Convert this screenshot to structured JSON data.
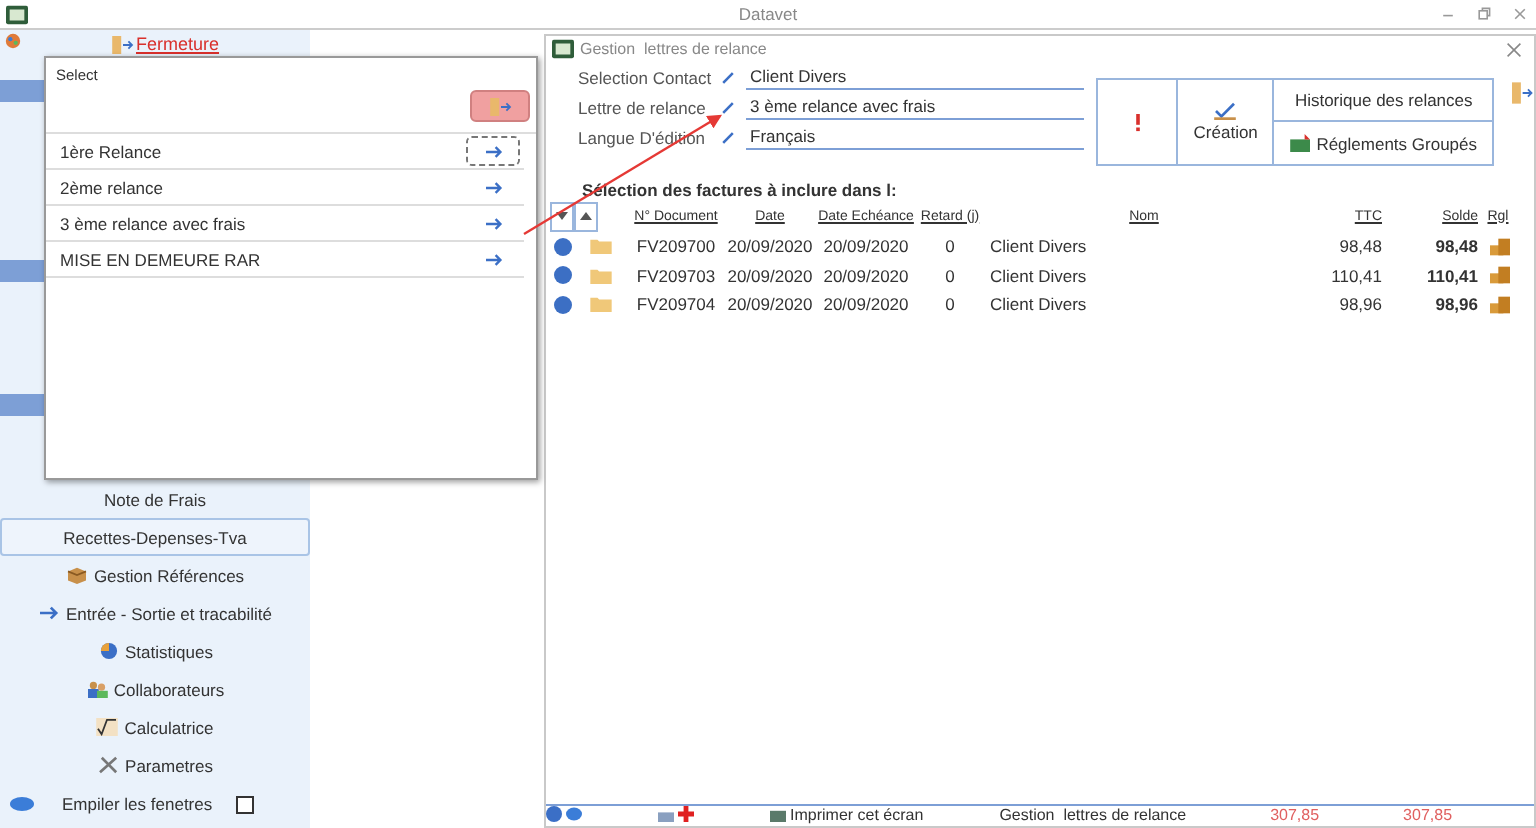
{
  "app": {
    "title": "Datavet"
  },
  "sidebar": {
    "close_link": "Fermeture",
    "items": [
      {
        "label": "Note de Frais",
        "selected": false
      },
      {
        "label": "Recettes-Depenses-Tva",
        "selected": true
      },
      {
        "label": "Gestion Références",
        "selected": false
      },
      {
        "label": "Entrée - Sortie et tracabilité",
        "selected": false
      },
      {
        "label": "Statistiques",
        "selected": false
      },
      {
        "label": "Collaborateurs",
        "selected": false
      },
      {
        "label": "Calculatrice",
        "selected": false
      },
      {
        "label": "Parametres",
        "selected": false
      }
    ],
    "stack_windows": {
      "label": "Empiler les fenetres",
      "checked": false
    }
  },
  "popup": {
    "title": "Select",
    "items": [
      {
        "label": "1ère Relance",
        "focused": true
      },
      {
        "label": "2ème relance",
        "focused": false
      },
      {
        "label": "3 ème relance avec frais",
        "focused": false
      },
      {
        "label": "MISE EN DEMEURE RAR",
        "focused": false
      }
    ]
  },
  "window": {
    "title": "Gestion  lettres de relance",
    "fields": [
      {
        "label": "Selection Contact",
        "value": "Client Divers"
      },
      {
        "label": "Lettre de relance",
        "value": "3 ème relance avec frais"
      },
      {
        "label": "Langue D'édition",
        "value": "Français"
      }
    ],
    "buttons": {
      "create": "Création",
      "history": "Historique des relances",
      "grouped": "Réglements Groupés"
    },
    "section_title": "Sélection des factures à inclure dans l:",
    "table": {
      "columns": [
        "N° Document",
        "Date",
        "Date Echéance",
        "Retard (j)",
        "Nom",
        "TTC",
        "Solde",
        "Rgl"
      ],
      "rows": [
        {
          "document": "FV209700",
          "date": "20/09/2020",
          "due": "20/09/2020",
          "delay": "0",
          "name": "Client Divers",
          "ttc": "98,48",
          "balance": "98,48"
        },
        {
          "document": "FV209703",
          "date": "20/09/2020",
          "due": "20/09/2020",
          "delay": "0",
          "name": "Client Divers",
          "ttc": "110,41",
          "balance": "110,41"
        },
        {
          "document": "FV209704",
          "date": "20/09/2020",
          "due": "20/09/2020",
          "delay": "0",
          "name": "Client Divers",
          "ttc": "98,96",
          "balance": "98,96"
        }
      ]
    },
    "footer": {
      "print": "Imprimer cet écran",
      "title": "Gestion  lettres de relance",
      "totals": [
        "307,85",
        "307,85"
      ]
    }
  }
}
